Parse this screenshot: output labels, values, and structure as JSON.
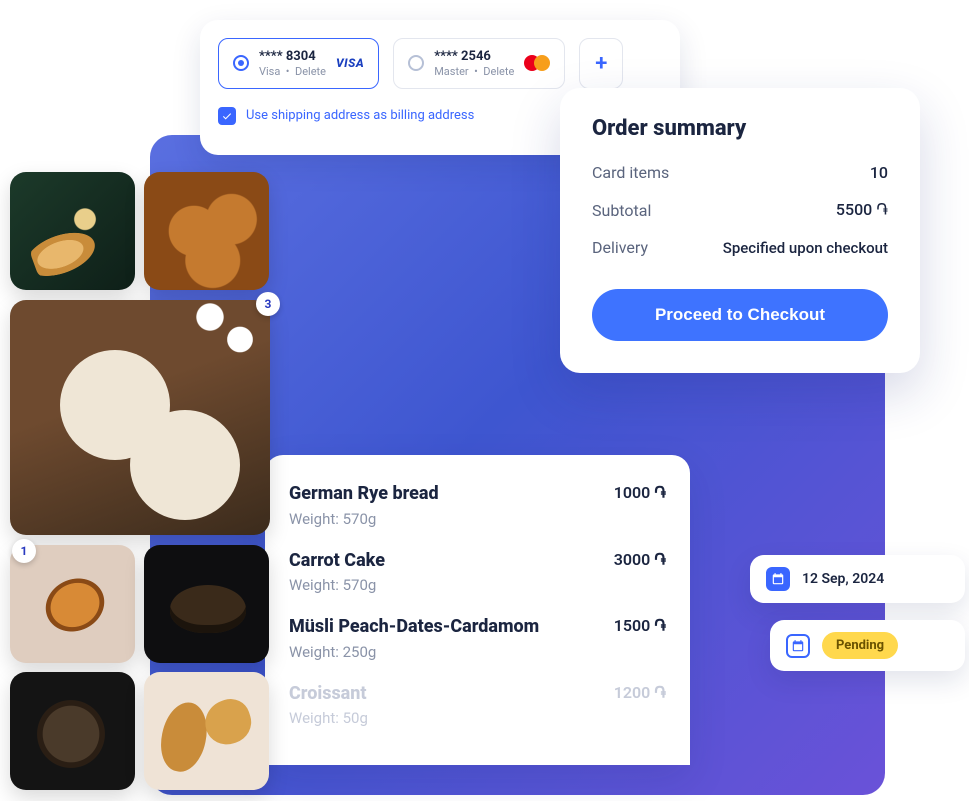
{
  "payment": {
    "cards": [
      {
        "masked": "**** 8304",
        "brand_label": "Visa",
        "delete_label": "Delete",
        "brand": "visa",
        "selected": true
      },
      {
        "masked": "**** 2546",
        "brand_label": "Master",
        "delete_label": "Delete",
        "brand": "mastercard",
        "selected": false
      }
    ],
    "add_label": "+",
    "shipping_as_billing": {
      "checked": true,
      "label": "Use shipping address as billing address"
    }
  },
  "order_summary": {
    "title": "Order summary",
    "rows": {
      "items": {
        "label": "Card items",
        "value": "10"
      },
      "subtotal": {
        "label": "Subtotal",
        "value": "5500 ֏"
      },
      "delivery": {
        "label": "Delivery",
        "value": "Specified upon checkout"
      }
    },
    "checkout_label": "Proceed to Checkout"
  },
  "products": [
    {
      "name": "German Rye bread",
      "weight_label": "Weight: 570g",
      "price": "1000 ֏",
      "faded": false
    },
    {
      "name": "Carrot Cake",
      "weight_label": "Weight: 570g",
      "price": "3000 ֏",
      "faded": false
    },
    {
      "name": "Müsli Peach-Dates-Cardamom",
      "weight_label": "Weight: 250g",
      "price": "1500 ֏",
      "faded": false
    },
    {
      "name": "Croissant",
      "weight_label": "Weight: 50g",
      "price": "1200 ֏",
      "faded": true
    }
  ],
  "date_card": {
    "date_text": "12 Sep, 2024"
  },
  "status_card": {
    "status_text": "Pending"
  },
  "photo_badges": {
    "top": "3",
    "left": "1"
  }
}
